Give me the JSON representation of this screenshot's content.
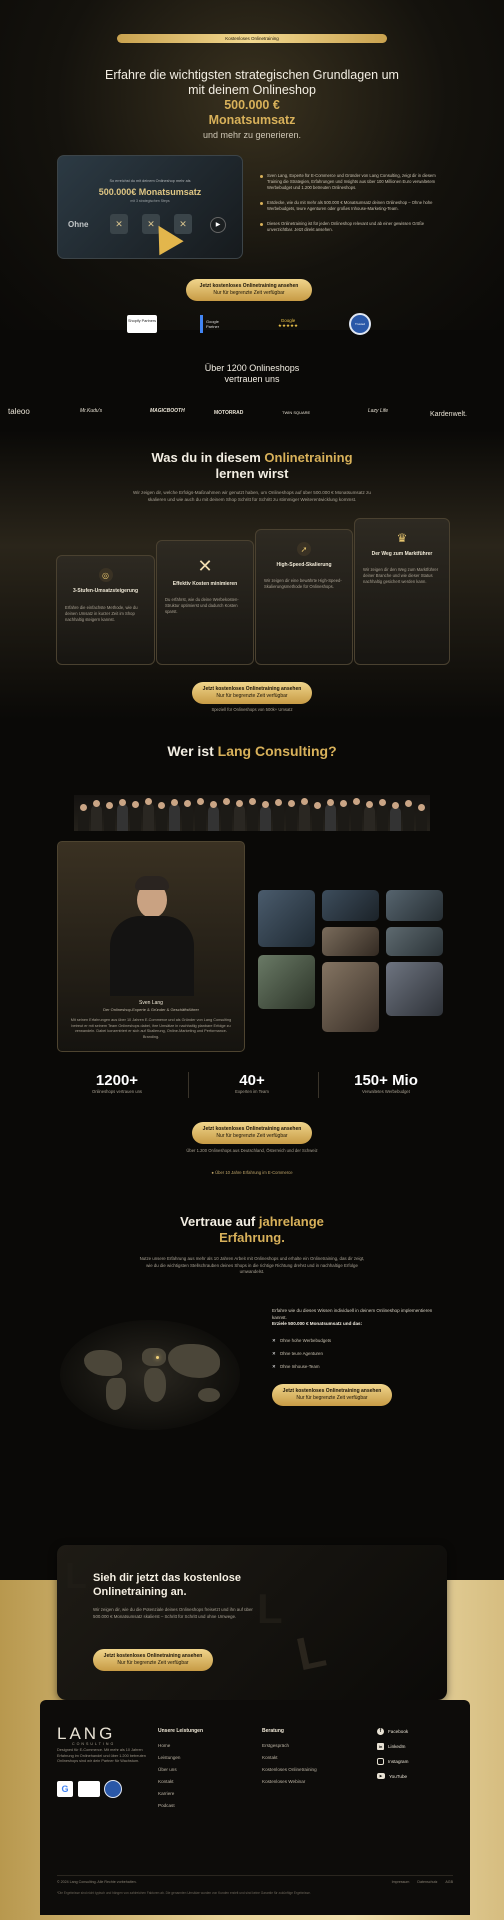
{
  "top_badge": "Kostenloses Onlinetraining",
  "hero": {
    "line1": "Erfahre die wichtigsten strategischen Grundlagen um",
    "line2": "mit deinem Onlineshop",
    "highlight1": "500.000 €",
    "highlight2": "Monatsumsatz",
    "line3": "und mehr zu generieren.",
    "video_top": "So erreichst du mit deinem Onlineshop mehr als",
    "video_title": "500.000€ Monatsumsatz",
    "video_sub": "mit 3 strategischen Steps",
    "video_left": "Ohne",
    "bullets": [
      "Sven Lang, Experte für E-Commerce und Gründer von Lang Consulting, zeigt dir in diesem Training die Strategien, Erfahrungen und Insights aus über 100 Millionen Euro verwaltetem Werbebudget und 1.200 betreuten Onlineshops.",
      "Entdecke, wie du mit mehr als 500.000 € Monatsumsatz deinen Onlineshop – Ohne hohe Werbebudgets, teure Agenturen oder großes Inhouse-Marketing-Team.",
      "Dieses Onlinetraining ist für jeden Onlineshop relevant und ab einer gewissen Größe unverzichtbar. Jetzt direkt ansehen."
    ],
    "cta_main": "Jetzt kostenloses Onlinetraining ansehen",
    "cta_sub": "Nur für begrenzte Zeit verfügbar"
  },
  "badges": [
    "Shopify Partners",
    "Google Partner",
    "Google ★★★★★",
    "Trusted Shops"
  ],
  "trust": {
    "title1": "Über 1200 Onlineshops",
    "title2": "vertrauen uns",
    "logos": [
      "taleoo",
      "Mr.Kudu's",
      "MAGICBOOTH",
      "MOTORRAD",
      "TWIN SQUARE",
      "Lazy Life",
      "Kardenwelt."
    ]
  },
  "learn": {
    "title1": "Was du in diesem",
    "title_gold": "Onlinetraining",
    "title2": "lernen wirst",
    "intro": "Wir zeigen dir, welche Erfolgs-Maßnahmen wir genutzt haben, um Onlineshops auf über 500.000 € Monatsumsatz zu skalieren und wie auch du mit deinem Shop Schritt für Schritt zu stimmiger Weiterentwicklung kommst.",
    "cards": [
      {
        "title": "3-Stufen-Umsatzsteigerung",
        "text": "Erfahre die einfachste Methode, wie du deinen Umsatz in kurzer Zeit im Shop nachhaltig steigern kannst."
      },
      {
        "title": "Effektiv Kosten minimieren",
        "text": "Du erfährst, wie du deine Werbekosten-Struktur optimierst und dadurch Kosten sparst."
      },
      {
        "title": "High-Speed-Skalierung",
        "text": "Wir zeigen dir eine bewährte High-Speed-Skalierungsmethode für Onlineshops."
      },
      {
        "title": "Der Weg zum Marktführer",
        "text": "Wir zeigen dir den Weg zum Marktführer deiner Branche und wie dieser Status nachhaltig gesichert werden kann."
      }
    ],
    "cta_main": "Jetzt kostenloses Onlinetraining ansehen",
    "cta_sub": "Nur für begrenzte Zeit verfügbar",
    "cta_note": "Speziell für Onlineshops von 500k+ Umsatz"
  },
  "who": {
    "title": "Wer ist",
    "title_gold": "Lang Consulting?",
    "name": "Sven Lang",
    "role": "Der Onlineshop-Experte & Gründer & Geschäftsführer",
    "bio": "Mit seinen Erfahrungen aus über 10 Jahren E-Commerce und als Gründer von Lang Consulting betreut er mit seinem Team Onlineshops dabei, ihre Umsätze in nachhaltig planbare Erfolge zu verwandeln. Dabei konzentriert er sich auf Skalierung, Online-Marketing und Performance-Branding."
  },
  "stats": [
    {
      "num": "1200+",
      "label": "Onlineshops vertrauen uns"
    },
    {
      "num": "40+",
      "label": "Experten im Team"
    },
    {
      "num": "150+ Mio",
      "label": "Verwaltetes Werbebudget"
    }
  ],
  "stats_cta": {
    "main": "Jetzt kostenloses Onlinetraining ansehen",
    "sub": "Nur für begrenzte Zeit verfügbar",
    "note": "Über 1.200 Onlineshops aus Deutschland, Österreich und der Schweiz"
  },
  "experience": {
    "eyebrow": "Über 10 Jahre Erfahrung im E-Commerce",
    "title1": "Vertraue auf",
    "title_gold1": "jahrelange",
    "title_gold2": "Erfahrung.",
    "text": "Nutze unsere Erfahrung aus mehr als 10 Jahren Arbeit mit Onlineshops und erhalte ein Onlinetraining, das dir zeigt, wie du die wichtigsten Stellschrauben deines Shops in die richtige Richtung drehst und in nachhaltige Erfolge umwandelst.",
    "right_intro": "Erfahre wie du dieses Wissen individuell in deinem Onlineshop implementieren kannst.",
    "right_bold": "Erziele 500.000 € Monatsumsatz und das:",
    "checks": [
      "Ohne hohe Werbebudgets",
      "Ohne teure Agenturen",
      "Ohne Inhouse-Team"
    ],
    "cta_main": "Jetzt kostenloses Onlinetraining ansehen",
    "cta_sub": "Nur für begrenzte Zeit verfügbar"
  },
  "final_cta": {
    "title1": "Sieh dir jetzt das kostenlose",
    "title2": "Onlinetraining an.",
    "text": "Wir zeigen dir, wie du die Potenziale deines Onlineshops freisetzt und ihn auf über 500.000 € Monatsumsatz skalierst – Schritt für Schritt und ohne Umwege.",
    "cta_main": "Jetzt kostenloses Onlinetraining ansehen",
    "cta_sub": "Nur für begrenzte Zeit verfügbar"
  },
  "footer": {
    "brand": "LANG",
    "brand_sub": "CONSULTING",
    "brand_text": "Designed für E-Commerce. Mit mehr als 10 Jahren Erfahrung im Onlinehandel und über 1.200 betreuten Onlineshops sind wir dein Partner für Wachstum.",
    "col1_title": "Unsere Leistungen",
    "col1": [
      "Home",
      "Leistungen",
      "Über uns",
      "Kontakt",
      "Karriere",
      "Podcast"
    ],
    "col2_title": "Beratung",
    "col2": [
      "Erstgespräch",
      "Kontakt",
      "Kostenloses Onlinetraining",
      "Kostenloses Webinar"
    ],
    "social": [
      "Facebook",
      "LinkedIn",
      "Instagram",
      "YouTube"
    ],
    "copyright": "© 2024 Lang Consulting. Alle Rechte vorbehalten.",
    "legal": [
      "Impressum",
      "Datenschutz",
      "AGB"
    ],
    "disclaimer": "*Die Ergebnisse sind nicht typisch und hängen von zahlreichen Faktoren ab. Die genannten Umsätze wurden von Kunden erzielt und sind keine Garantie für zukünftige Ergebnisse."
  }
}
